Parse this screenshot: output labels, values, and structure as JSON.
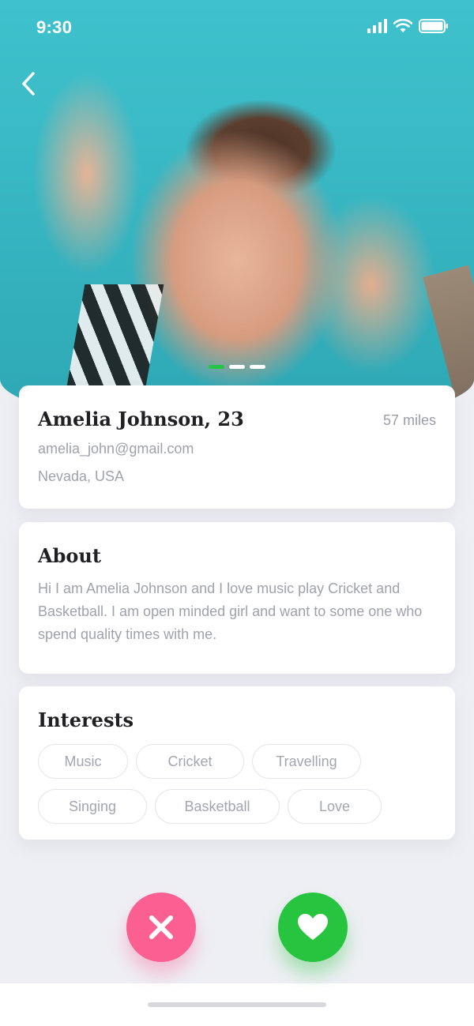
{
  "status_bar": {
    "time": "9:30",
    "icons": [
      "signal-icon",
      "wifi-icon",
      "battery-icon"
    ]
  },
  "navigation": {
    "back_icon": "chevron-left-icon"
  },
  "photo_carousel": {
    "page_count": 3,
    "active_index": 0,
    "active_color": "#27c44a"
  },
  "profile": {
    "name": "Amelia Johnson, 23",
    "distance": "57 miles",
    "email": "amelia_john@gmail.com",
    "location": "Nevada, USA"
  },
  "about": {
    "title": "About",
    "text": "Hi I am Amelia Johnson and I love music play Cricket and Basketball. I am open minded girl and want to some one who spend quality times with me."
  },
  "interests": {
    "title": "Interests",
    "items": [
      "Music",
      "Cricket",
      "Travelling",
      "Singing",
      "Basketball",
      "Love"
    ]
  },
  "actions": {
    "reject": {
      "icon": "close-icon",
      "color": "#fc5f92"
    },
    "like": {
      "icon": "heart-icon",
      "color": "#27c43f"
    }
  }
}
